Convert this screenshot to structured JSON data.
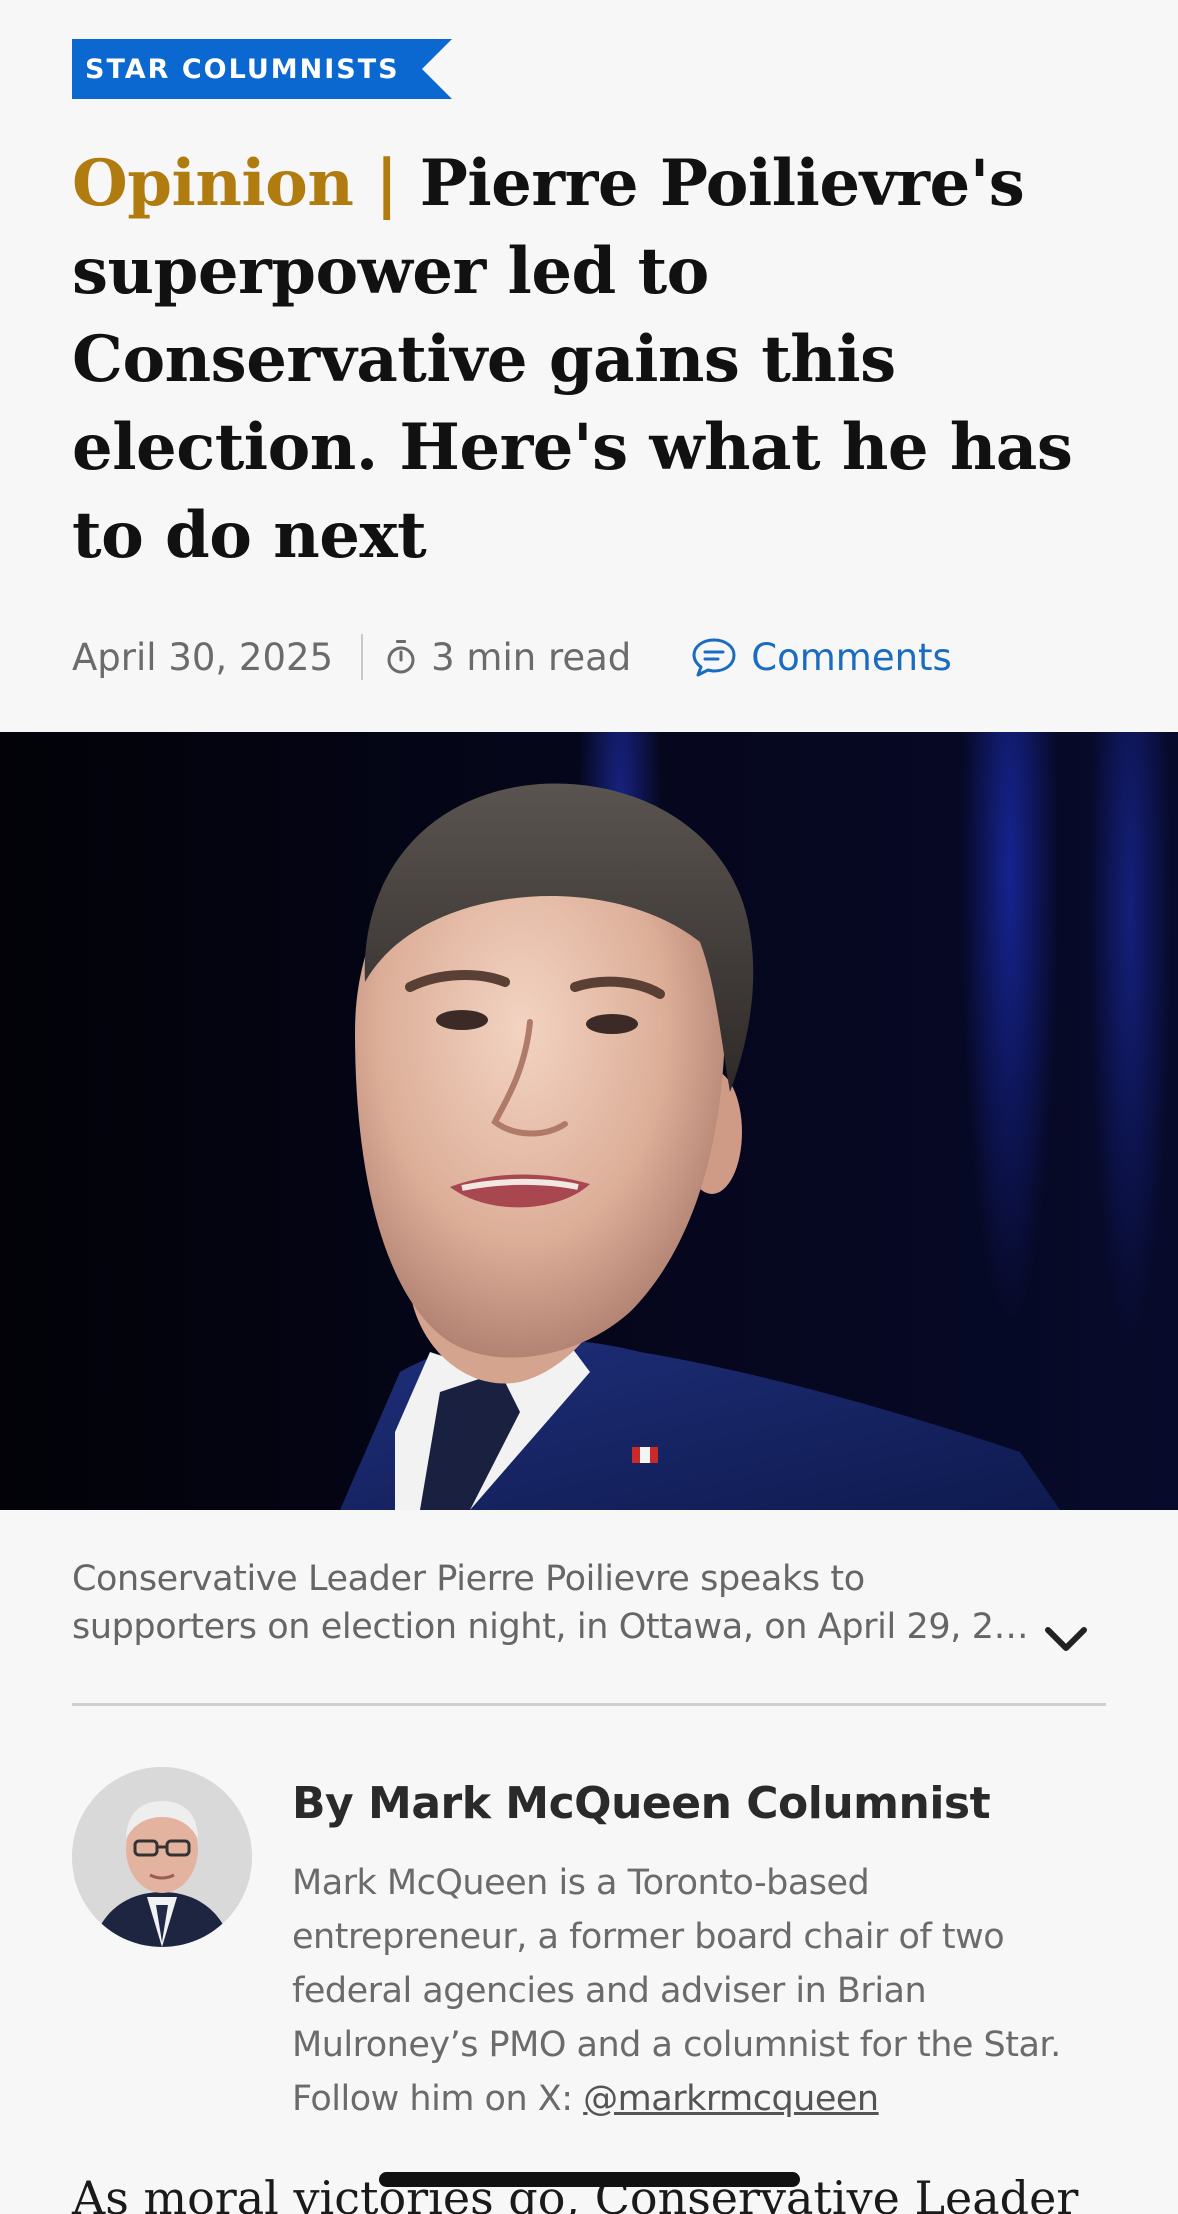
{
  "section_badge": "STAR COLUMNISTS",
  "headline": {
    "kicker": "Opinion |",
    "title": "Pierre Poilievre's superpower led to Conservative gains this election. Here's what he has to do next"
  },
  "meta": {
    "date": "April 30, 2025",
    "read_time": "3 min read",
    "comments_label": "Comments",
    "timer_icon": "timer-icon",
    "comments_icon": "comment-bubble-icon"
  },
  "hero_image": {
    "alt": "Conservative Leader Pierre Poilievre speaking in front of a dark blue background"
  },
  "caption": {
    "line1": "Conservative Leader Pierre Poilievre speaks to",
    "line2": "supporters on election night, in Ottawa, on April 29, 2…",
    "toggle_icon": "chevron-down-icon"
  },
  "author": {
    "byline": "By Mark McQueen Columnist",
    "bio": "Mark McQueen is a Toronto-based entrepreneur, a former board chair of two federal agencies and adviser in Brian Mulroney’s PMO and a columnist for the Star. Follow him on X: ",
    "handle": "@markrmcqueen"
  },
  "article": {
    "lede": "As moral victories go, Conservative Leader"
  },
  "colors": {
    "badge_blue": "#0a68d0",
    "kicker_gold": "#b07b0f",
    "link_blue": "#1a6cc0"
  }
}
